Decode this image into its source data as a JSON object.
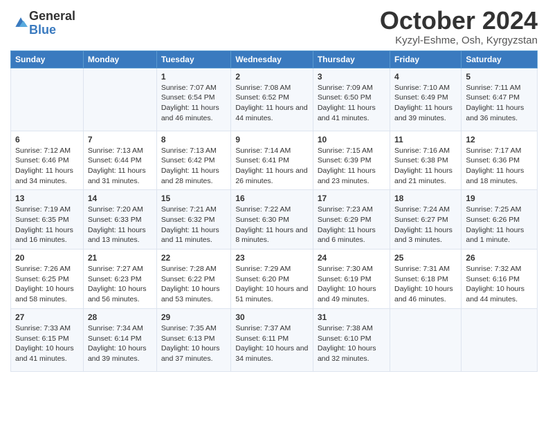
{
  "logo": {
    "general": "General",
    "blue": "Blue"
  },
  "title": "October 2024",
  "location": "Kyzyl-Eshme, Osh, Kyrgyzstan",
  "days_of_week": [
    "Sunday",
    "Monday",
    "Tuesday",
    "Wednesday",
    "Thursday",
    "Friday",
    "Saturday"
  ],
  "weeks": [
    [
      {
        "day": "",
        "sunrise": "",
        "sunset": "",
        "daylight": ""
      },
      {
        "day": "",
        "sunrise": "",
        "sunset": "",
        "daylight": ""
      },
      {
        "day": "1",
        "sunrise": "Sunrise: 7:07 AM",
        "sunset": "Sunset: 6:54 PM",
        "daylight": "Daylight: 11 hours and 46 minutes."
      },
      {
        "day": "2",
        "sunrise": "Sunrise: 7:08 AM",
        "sunset": "Sunset: 6:52 PM",
        "daylight": "Daylight: 11 hours and 44 minutes."
      },
      {
        "day": "3",
        "sunrise": "Sunrise: 7:09 AM",
        "sunset": "Sunset: 6:50 PM",
        "daylight": "Daylight: 11 hours and 41 minutes."
      },
      {
        "day": "4",
        "sunrise": "Sunrise: 7:10 AM",
        "sunset": "Sunset: 6:49 PM",
        "daylight": "Daylight: 11 hours and 39 minutes."
      },
      {
        "day": "5",
        "sunrise": "Sunrise: 7:11 AM",
        "sunset": "Sunset: 6:47 PM",
        "daylight": "Daylight: 11 hours and 36 minutes."
      }
    ],
    [
      {
        "day": "6",
        "sunrise": "Sunrise: 7:12 AM",
        "sunset": "Sunset: 6:46 PM",
        "daylight": "Daylight: 11 hours and 34 minutes."
      },
      {
        "day": "7",
        "sunrise": "Sunrise: 7:13 AM",
        "sunset": "Sunset: 6:44 PM",
        "daylight": "Daylight: 11 hours and 31 minutes."
      },
      {
        "day": "8",
        "sunrise": "Sunrise: 7:13 AM",
        "sunset": "Sunset: 6:42 PM",
        "daylight": "Daylight: 11 hours and 28 minutes."
      },
      {
        "day": "9",
        "sunrise": "Sunrise: 7:14 AM",
        "sunset": "Sunset: 6:41 PM",
        "daylight": "Daylight: 11 hours and 26 minutes."
      },
      {
        "day": "10",
        "sunrise": "Sunrise: 7:15 AM",
        "sunset": "Sunset: 6:39 PM",
        "daylight": "Daylight: 11 hours and 23 minutes."
      },
      {
        "day": "11",
        "sunrise": "Sunrise: 7:16 AM",
        "sunset": "Sunset: 6:38 PM",
        "daylight": "Daylight: 11 hours and 21 minutes."
      },
      {
        "day": "12",
        "sunrise": "Sunrise: 7:17 AM",
        "sunset": "Sunset: 6:36 PM",
        "daylight": "Daylight: 11 hours and 18 minutes."
      }
    ],
    [
      {
        "day": "13",
        "sunrise": "Sunrise: 7:19 AM",
        "sunset": "Sunset: 6:35 PM",
        "daylight": "Daylight: 11 hours and 16 minutes."
      },
      {
        "day": "14",
        "sunrise": "Sunrise: 7:20 AM",
        "sunset": "Sunset: 6:33 PM",
        "daylight": "Daylight: 11 hours and 13 minutes."
      },
      {
        "day": "15",
        "sunrise": "Sunrise: 7:21 AM",
        "sunset": "Sunset: 6:32 PM",
        "daylight": "Daylight: 11 hours and 11 minutes."
      },
      {
        "day": "16",
        "sunrise": "Sunrise: 7:22 AM",
        "sunset": "Sunset: 6:30 PM",
        "daylight": "Daylight: 11 hours and 8 minutes."
      },
      {
        "day": "17",
        "sunrise": "Sunrise: 7:23 AM",
        "sunset": "Sunset: 6:29 PM",
        "daylight": "Daylight: 11 hours and 6 minutes."
      },
      {
        "day": "18",
        "sunrise": "Sunrise: 7:24 AM",
        "sunset": "Sunset: 6:27 PM",
        "daylight": "Daylight: 11 hours and 3 minutes."
      },
      {
        "day": "19",
        "sunrise": "Sunrise: 7:25 AM",
        "sunset": "Sunset: 6:26 PM",
        "daylight": "Daylight: 11 hours and 1 minute."
      }
    ],
    [
      {
        "day": "20",
        "sunrise": "Sunrise: 7:26 AM",
        "sunset": "Sunset: 6:25 PM",
        "daylight": "Daylight: 10 hours and 58 minutes."
      },
      {
        "day": "21",
        "sunrise": "Sunrise: 7:27 AM",
        "sunset": "Sunset: 6:23 PM",
        "daylight": "Daylight: 10 hours and 56 minutes."
      },
      {
        "day": "22",
        "sunrise": "Sunrise: 7:28 AM",
        "sunset": "Sunset: 6:22 PM",
        "daylight": "Daylight: 10 hours and 53 minutes."
      },
      {
        "day": "23",
        "sunrise": "Sunrise: 7:29 AM",
        "sunset": "Sunset: 6:20 PM",
        "daylight": "Daylight: 10 hours and 51 minutes."
      },
      {
        "day": "24",
        "sunrise": "Sunrise: 7:30 AM",
        "sunset": "Sunset: 6:19 PM",
        "daylight": "Daylight: 10 hours and 49 minutes."
      },
      {
        "day": "25",
        "sunrise": "Sunrise: 7:31 AM",
        "sunset": "Sunset: 6:18 PM",
        "daylight": "Daylight: 10 hours and 46 minutes."
      },
      {
        "day": "26",
        "sunrise": "Sunrise: 7:32 AM",
        "sunset": "Sunset: 6:16 PM",
        "daylight": "Daylight: 10 hours and 44 minutes."
      }
    ],
    [
      {
        "day": "27",
        "sunrise": "Sunrise: 7:33 AM",
        "sunset": "Sunset: 6:15 PM",
        "daylight": "Daylight: 10 hours and 41 minutes."
      },
      {
        "day": "28",
        "sunrise": "Sunrise: 7:34 AM",
        "sunset": "Sunset: 6:14 PM",
        "daylight": "Daylight: 10 hours and 39 minutes."
      },
      {
        "day": "29",
        "sunrise": "Sunrise: 7:35 AM",
        "sunset": "Sunset: 6:13 PM",
        "daylight": "Daylight: 10 hours and 37 minutes."
      },
      {
        "day": "30",
        "sunrise": "Sunrise: 7:37 AM",
        "sunset": "Sunset: 6:11 PM",
        "daylight": "Daylight: 10 hours and 34 minutes."
      },
      {
        "day": "31",
        "sunrise": "Sunrise: 7:38 AM",
        "sunset": "Sunset: 6:10 PM",
        "daylight": "Daylight: 10 hours and 32 minutes."
      },
      {
        "day": "",
        "sunrise": "",
        "sunset": "",
        "daylight": ""
      },
      {
        "day": "",
        "sunrise": "",
        "sunset": "",
        "daylight": ""
      }
    ]
  ]
}
